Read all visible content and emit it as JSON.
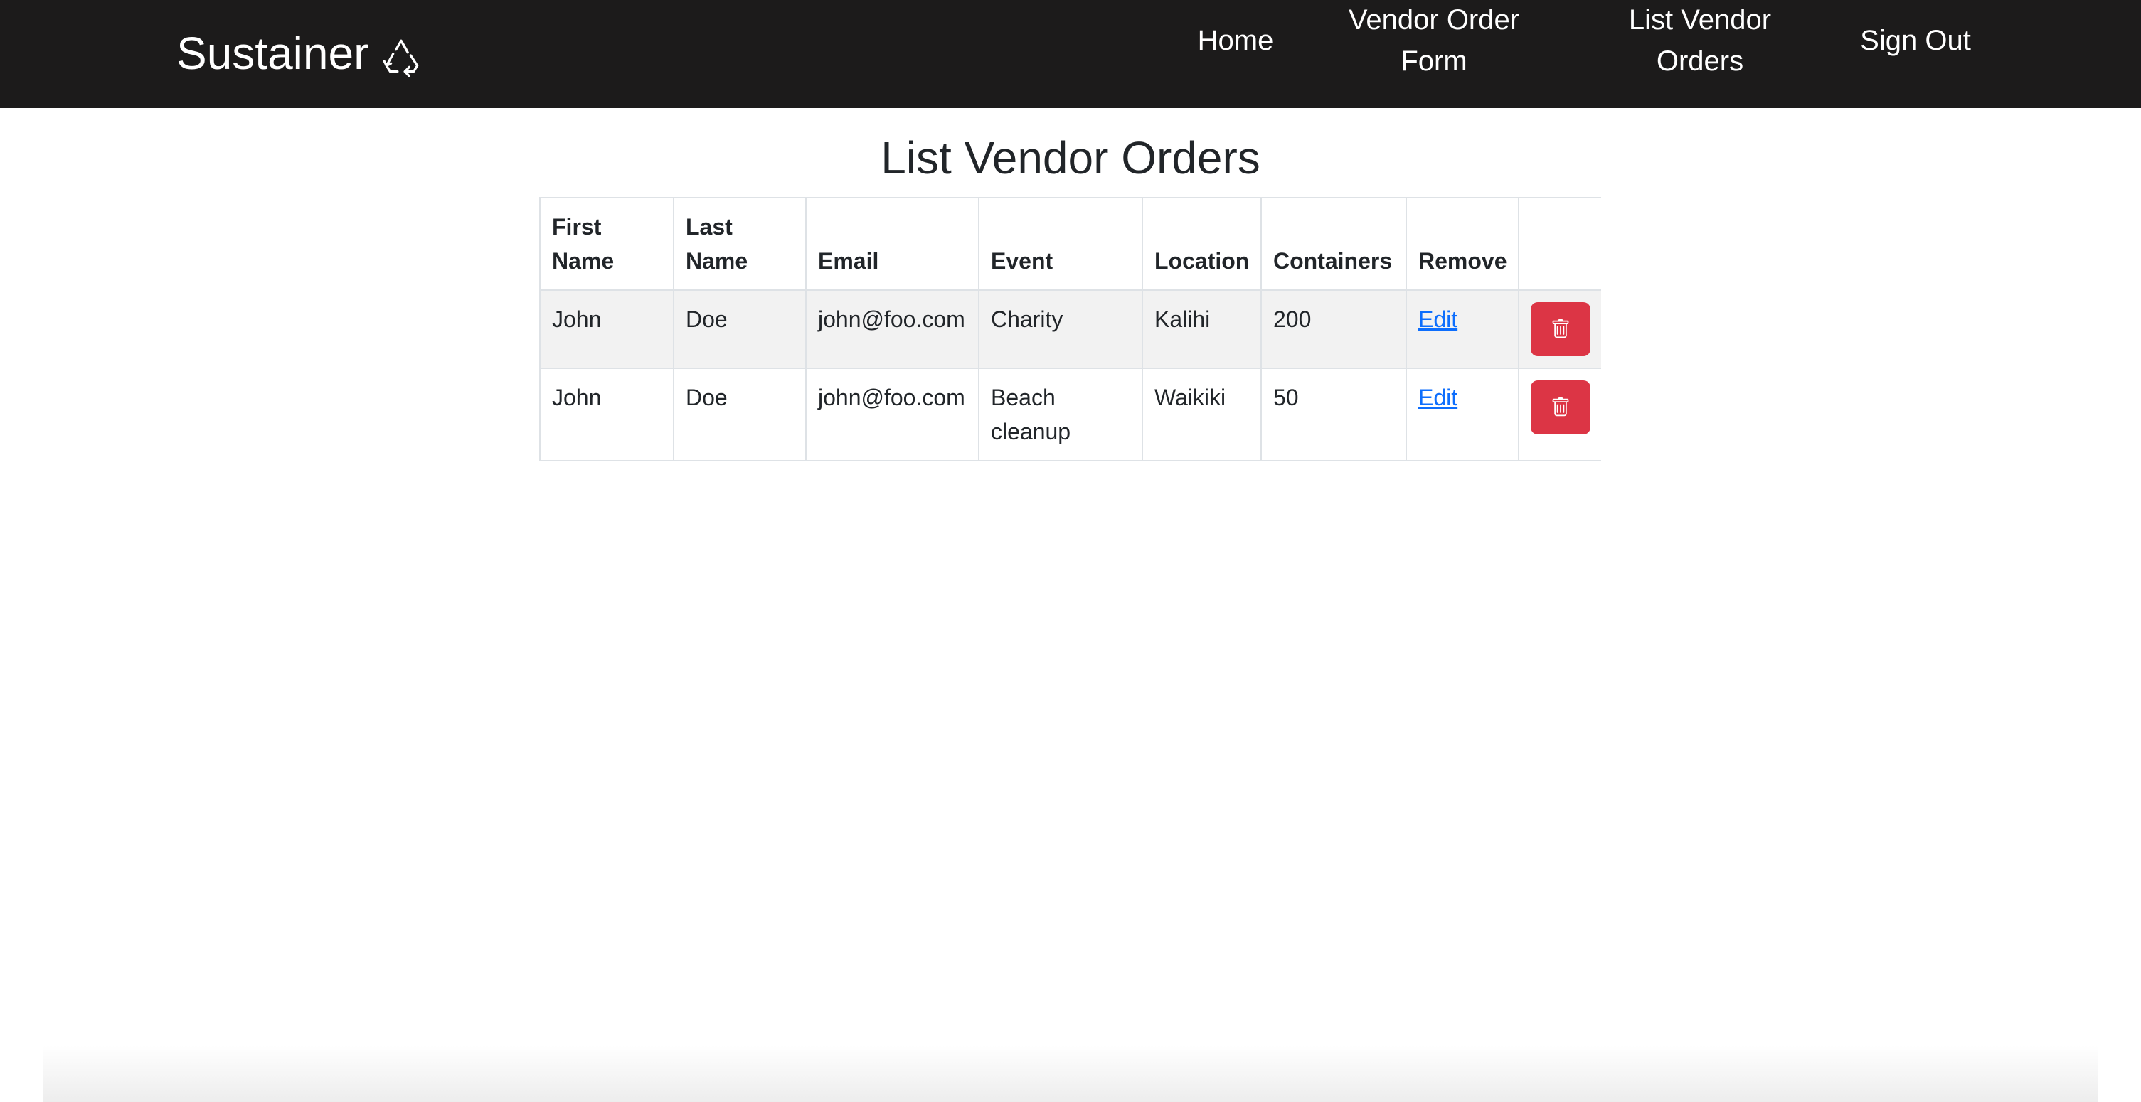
{
  "navbar": {
    "brand": "Sustainer",
    "brand_icon": "recycle-icon",
    "links": {
      "home": "Home",
      "vendor_order_form_line1": "Vendor Order",
      "vendor_order_form_line2": "Form",
      "list_vendor_orders_line1": "List Vendor",
      "list_vendor_orders_line2": "Orders",
      "sign_out": "Sign Out"
    },
    "background_color": "#1c1b1b"
  },
  "page": {
    "title": "List Vendor Orders"
  },
  "table": {
    "headers": {
      "first_name_line1": "First",
      "first_name_line2": "Name",
      "last_name_line1": "Last",
      "last_name_line2": "Name",
      "email": "Email",
      "event": "Event",
      "location": "Location",
      "containers": "Containers",
      "remove": "Remove"
    },
    "rows": [
      {
        "first_name": "John",
        "last_name": "Doe",
        "email": "john@foo.com",
        "event": "Charity",
        "location": "Kalihi",
        "containers": "200",
        "edit": "Edit",
        "delete_icon": "trash-icon"
      },
      {
        "first_name": "John",
        "last_name": "Doe",
        "email": "john@foo.com",
        "event": "Beach cleanup",
        "location": "Waikiki",
        "containers": "50",
        "edit": "Edit",
        "delete_icon": "trash-icon"
      }
    ],
    "delete_button_color": "#dc3545",
    "link_color": "#0d6efd"
  }
}
